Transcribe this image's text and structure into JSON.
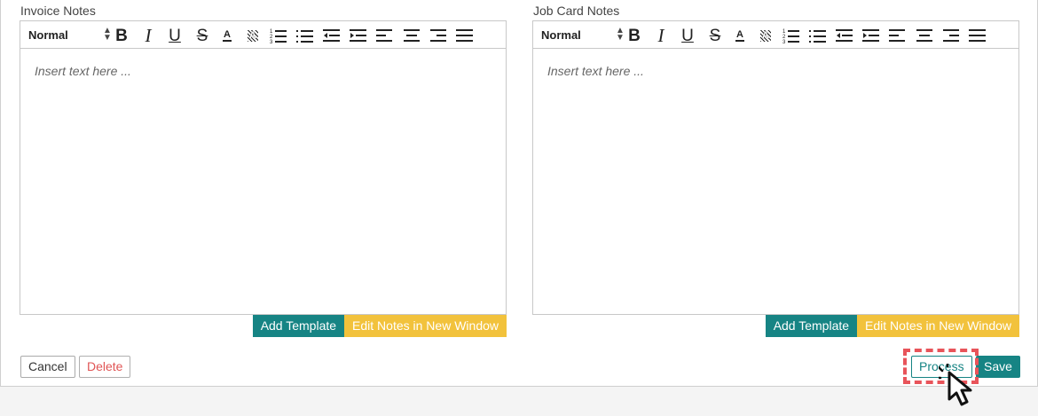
{
  "editors": [
    {
      "label": "Invoice Notes",
      "format": "Normal",
      "placeholder": "Insert text here ...",
      "add_template_label": "Add Template",
      "edit_window_label": "Edit Notes in New Window"
    },
    {
      "label": "Job Card Notes",
      "format": "Normal",
      "placeholder": "Insert text here ...",
      "add_template_label": "Add Template",
      "edit_window_label": "Edit Notes in New Window"
    }
  ],
  "toolbar": {
    "bold": "B",
    "italic": "I",
    "underline": "U",
    "strike": "S",
    "text_color": "A",
    "background_color": "A",
    "icons": [
      "bold-icon",
      "italic-icon",
      "underline-icon",
      "strikethrough-icon",
      "text-color-icon",
      "background-color-icon",
      "ordered-list-icon",
      "bullet-list-icon",
      "outdent-icon",
      "indent-icon",
      "align-left-icon",
      "align-center-icon",
      "align-right-icon",
      "align-justify-icon"
    ]
  },
  "footer": {
    "cancel_label": "Cancel",
    "delete_label": "Delete",
    "process_label": "Process",
    "save_label": "Save"
  },
  "colors": {
    "teal": "#168484",
    "yellow": "#f2c23c",
    "delete_red": "#e05555",
    "highlight": "#e8545a"
  }
}
